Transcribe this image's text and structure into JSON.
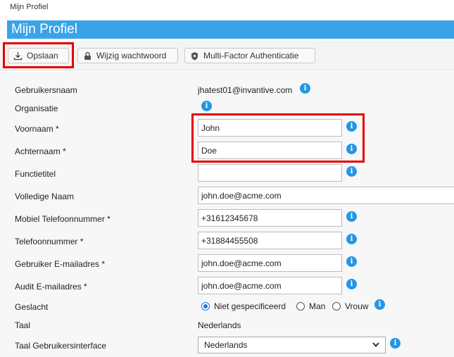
{
  "breadcrumb": "Mijn Profiel",
  "page_title": "Mijn Profiel",
  "toolbar": {
    "save_label": "Opslaan",
    "password_label": "Wijzig wachtwoord",
    "mfa_label": "Multi-Factor Authenticatie"
  },
  "form": {
    "username_label": "Gebruikersnaam",
    "username_value": "jhatest01@invantive.com",
    "organisation_label": "Organisatie",
    "firstname_label": "Voornaam *",
    "firstname_value": "John",
    "lastname_label": "Achternaam *",
    "lastname_value": "Doe",
    "jobtitle_label": "Functietitel",
    "jobtitle_value": "",
    "fullname_label": "Volledige Naam",
    "fullname_value": "john.doe@acme.com",
    "mobile_label": "Mobiel Telefoonnummer *",
    "mobile_value": "+31612345678",
    "phone_label": "Telefoonnummer *",
    "phone_value": "+31884455508",
    "email_label": "Gebruiker E-mailadres *",
    "email_value": "john.doe@acme.com",
    "audit_email_label": "Audit E-mailadres *",
    "audit_email_value": "john.doe@acme.com",
    "gender_label": "Geslacht",
    "gender_options": [
      "Niet gespecificeerd",
      "Man",
      "Vrouw"
    ],
    "gender_selected": "Niet gespecificeerd",
    "language_label": "Taal",
    "language_value": "Nederlands",
    "ui_language_label": "Taal Gebruikersinterface",
    "ui_language_value": "Nederlands"
  },
  "icons": {
    "info": "info-icon",
    "save": "download-icon",
    "password": "lock-icon",
    "mfa": "shield-icon",
    "select": "chevron-down-icon"
  },
  "colors": {
    "accent": "#3aa3e8",
    "info": "#2496e6",
    "highlight": "#e40000"
  }
}
